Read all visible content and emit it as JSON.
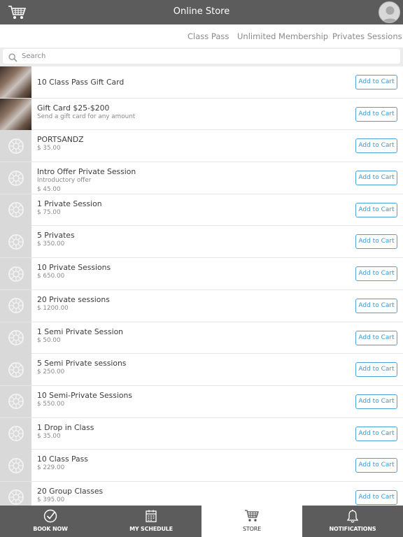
{
  "header": {
    "title": "Online Store",
    "cart_icon": "cart-icon",
    "avatar_icon": "user-avatar-icon"
  },
  "tabs": [
    {
      "label": "Class Pass"
    },
    {
      "label": "Unlimited Membership"
    },
    {
      "label": "Privates Sessions"
    }
  ],
  "search": {
    "placeholder": "Search",
    "value": ""
  },
  "items": [
    {
      "name": "10 Class Pass Gift Card",
      "subtitle": "",
      "price": "",
      "button": "Add to Cart",
      "thumb": "photo"
    },
    {
      "name": "Gift Card $25-$200",
      "subtitle": "Send a gift card for any amount",
      "price": "",
      "button": "Add to Cart",
      "thumb": "photo"
    },
    {
      "name": "PORTSANDZ",
      "subtitle": "",
      "price": "$ 35.00",
      "button": "Add to Cart",
      "thumb": "placeholder"
    },
    {
      "name": "Intro Offer Private Session",
      "subtitle": "Introductory offer",
      "price": "$ 45.00",
      "button": "Add to Cart",
      "thumb": "placeholder"
    },
    {
      "name": "1 Private Session",
      "subtitle": "",
      "price": "$ 75.00",
      "button": "Add to Cart",
      "thumb": "placeholder"
    },
    {
      "name": "5 Privates",
      "subtitle": "",
      "price": "$ 350.00",
      "button": "Add to Cart",
      "thumb": "placeholder"
    },
    {
      "name": "10 Private Sessions",
      "subtitle": "",
      "price": "$ 650.00",
      "button": "Add to Cart",
      "thumb": "placeholder"
    },
    {
      "name": "20 Private sessions",
      "subtitle": "",
      "price": "$ 1200.00",
      "button": "Add to Cart",
      "thumb": "placeholder"
    },
    {
      "name": "1 Semi Private Session",
      "subtitle": "",
      "price": "$ 50.00",
      "button": "Add to Cart",
      "thumb": "placeholder"
    },
    {
      "name": "5 Semi Private sessions",
      "subtitle": "",
      "price": "$ 250.00",
      "button": "Add to Cart",
      "thumb": "placeholder"
    },
    {
      "name": "10 Semi-Private Sessions",
      "subtitle": "",
      "price": "$ 550.00",
      "button": "Add to Cart",
      "thumb": "placeholder"
    },
    {
      "name": "1 Drop in Class",
      "subtitle": "",
      "price": "$ 35.00",
      "button": "Add to Cart",
      "thumb": "placeholder"
    },
    {
      "name": "10 Class Pass",
      "subtitle": "",
      "price": "$ 229.00",
      "button": "Add to Cart",
      "thumb": "placeholder"
    },
    {
      "name": "20 Group Classes",
      "subtitle": "",
      "price": "$ 395.00",
      "button": "Add to Cart",
      "thumb": "placeholder"
    }
  ],
  "bottom_nav": [
    {
      "label": "BOOK NOW",
      "icon": "check-circle-icon",
      "active": false
    },
    {
      "label": "MY SCHEDULE",
      "icon": "calendar-icon",
      "active": false
    },
    {
      "label": "STORE",
      "icon": "cart-icon",
      "active": true
    },
    {
      "label": "NOTIFICATIONS",
      "icon": "bell-icon",
      "active": false
    }
  ],
  "colors": {
    "bar": "#5c5c5c",
    "accent": "#3a98d0",
    "divider": "#e6e6e6"
  }
}
